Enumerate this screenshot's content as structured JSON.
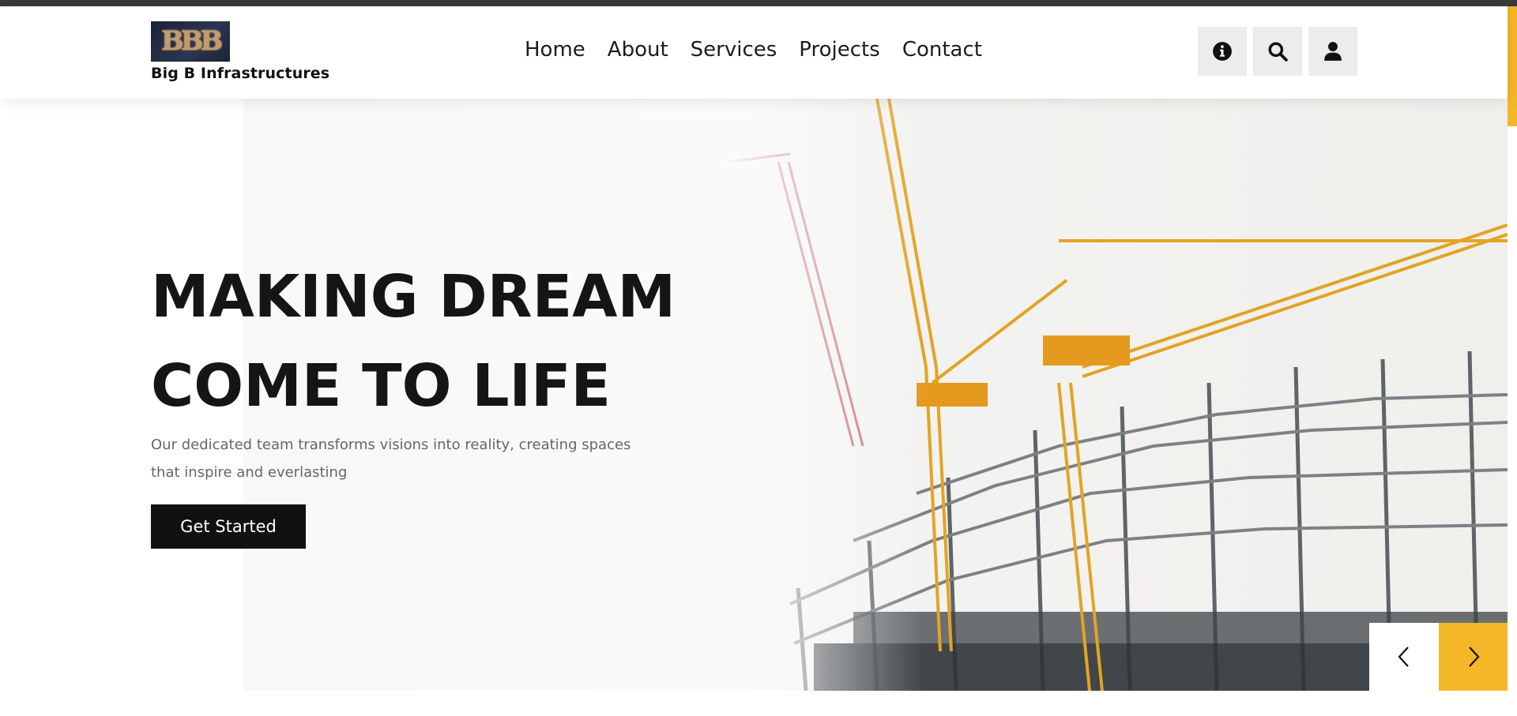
{
  "brand": {
    "logo_text": "BBB",
    "name": "Big B Infrastructures"
  },
  "nav": {
    "items": [
      "Home",
      "About",
      "Services",
      "Projects",
      "Contact"
    ]
  },
  "header_icons": [
    "info-icon",
    "search-icon",
    "user-icon"
  ],
  "hero": {
    "title_line1": "MAKING DREAM",
    "title_line2": "COME TO LIFE",
    "subtitle": "Our dedicated team transforms visions into reality, creating spaces that inspire and everlasting",
    "cta_label": "Get Started"
  },
  "slider": {
    "prev_icon": "chevron-left-icon",
    "next_icon": "chevron-right-icon"
  },
  "colors": {
    "accent": "#f4b728",
    "dark": "#111111",
    "topbar": "#3a3a3a"
  }
}
